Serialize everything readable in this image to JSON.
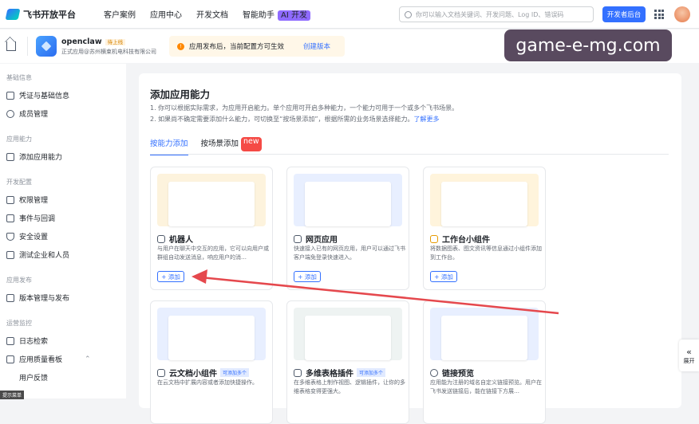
{
  "topbar": {
    "logo_text": "飞书开放平台",
    "nav": [
      "客户案例",
      "应用中心",
      "开发文档",
      "智能助手"
    ],
    "ai_badge": "AI 开发",
    "search_placeholder": "你可以输入文档关键词、开发问题、Log ID、错误码",
    "dev_button": "开发者后台"
  },
  "app": {
    "name": "openclaw",
    "status": "待上线",
    "subtitle": "正式应用@苏州横束机电科技有限公司",
    "notice": "应用发布后，当前配置方可生效",
    "notice_link": "创建版本"
  },
  "watermark": "game-e-mg.com",
  "sidebar": [
    {
      "section": "基础信息",
      "items": [
        "凭证与基础信息",
        "成员管理"
      ]
    },
    {
      "section": "应用能力",
      "items": [
        "添加应用能力"
      ]
    },
    {
      "section": "开发配置",
      "items": [
        "权限管理",
        "事件与回调",
        "安全设置",
        "测试企业和人员"
      ]
    },
    {
      "section": "应用发布",
      "items": [
        "版本管理与发布"
      ]
    },
    {
      "section": "运营监控",
      "items": [
        "日志检索",
        "应用质量看板",
        "用户反馈"
      ]
    }
  ],
  "main": {
    "title": "添加应用能力",
    "desc1": "1. 你可以根据实际需求，为应用开启能力。单个应用可开启多种能力，一个能力可用于一个或多个飞书场景。",
    "desc2": "2. 如果尚不确定需要添加什么能力，可切换至“按场景添加”，根据所需的业务场景选择能力。",
    "desc2_link": "了解更多",
    "tabs": [
      "按能力添加",
      "按场景添加"
    ],
    "new_badge": "new",
    "add_label": "+ 添加"
  },
  "cards": [
    {
      "title": "机器人",
      "tag": "",
      "desc": "与用户在聊天中交互的应用，它可以向用户或群组自动发送消息，响应用户的消…",
      "preview_color": "#fdf3dd"
    },
    {
      "title": "网页应用",
      "tag": "",
      "desc": "快速接入已有的网页应用，用户可以通过飞书客户端免登录快速进入。",
      "preview_color": "#e8efff"
    },
    {
      "title": "工作台小组件",
      "tag": "",
      "desc": "将数据图表、图文资讯等信息通过小组件添加到工作台。",
      "preview_color": "#fff4dc"
    },
    {
      "title": "云文档小组件",
      "tag": "可添加多个",
      "desc": "在云文档中扩展内容或者添加快捷操作。",
      "preview_color": "#e8efff"
    },
    {
      "title": "多维表格插件",
      "tag": "可添加多个",
      "desc": "在多维表格上制作视图、逻辑插件，让你的多维表格变得更强大。",
      "preview_color": "#eef3f2"
    },
    {
      "title": "链接预览",
      "tag": "",
      "desc": "应用能为注册的域名自定义链接预览。用户在飞书发送链接后，能在链接下方展…",
      "preview_color": "#e8efff"
    }
  ],
  "expand_label": "展开",
  "tip_badge": "提示菜单",
  "colors": {
    "accent": "#3370ff",
    "arrow": "#e5484d"
  }
}
